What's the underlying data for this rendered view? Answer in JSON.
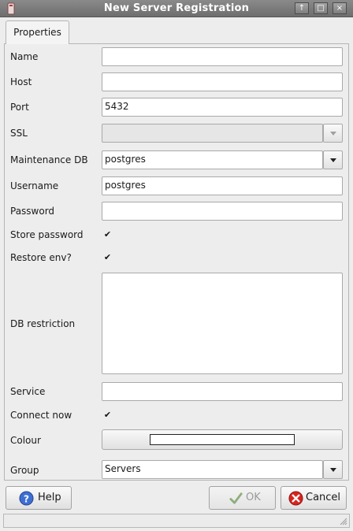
{
  "window": {
    "title": "New Server Registration"
  },
  "tabs": [
    {
      "label": "Properties"
    }
  ],
  "form": {
    "name": {
      "label": "Name",
      "value": ""
    },
    "host": {
      "label": "Host",
      "value": ""
    },
    "port": {
      "label": "Port",
      "value": "5432"
    },
    "ssl": {
      "label": "SSL",
      "value": ""
    },
    "maintenance_db": {
      "label": "Maintenance DB",
      "value": "postgres"
    },
    "username": {
      "label": "Username",
      "value": "postgres"
    },
    "password": {
      "label": "Password",
      "value": ""
    },
    "store_password": {
      "label": "Store password",
      "checked": true
    },
    "restore_env": {
      "label": "Restore env?",
      "checked": true
    },
    "db_restriction": {
      "label": "DB restriction",
      "value": ""
    },
    "service": {
      "label": "Service",
      "value": ""
    },
    "connect_now": {
      "label": "Connect now",
      "checked": true
    },
    "colour": {
      "label": "Colour",
      "swatch": "#ffffff"
    },
    "group": {
      "label": "Group",
      "value": "Servers"
    }
  },
  "buttons": {
    "help": "Help",
    "ok": "OK",
    "cancel": "Cancel"
  },
  "glyphs": {
    "check": "✔",
    "up": "↑",
    "max": "□",
    "close": "×"
  },
  "colors": {
    "help_icon": "#3d6fd3",
    "cancel_icon": "#d9231e",
    "ok_icon": "#7fa06a"
  }
}
